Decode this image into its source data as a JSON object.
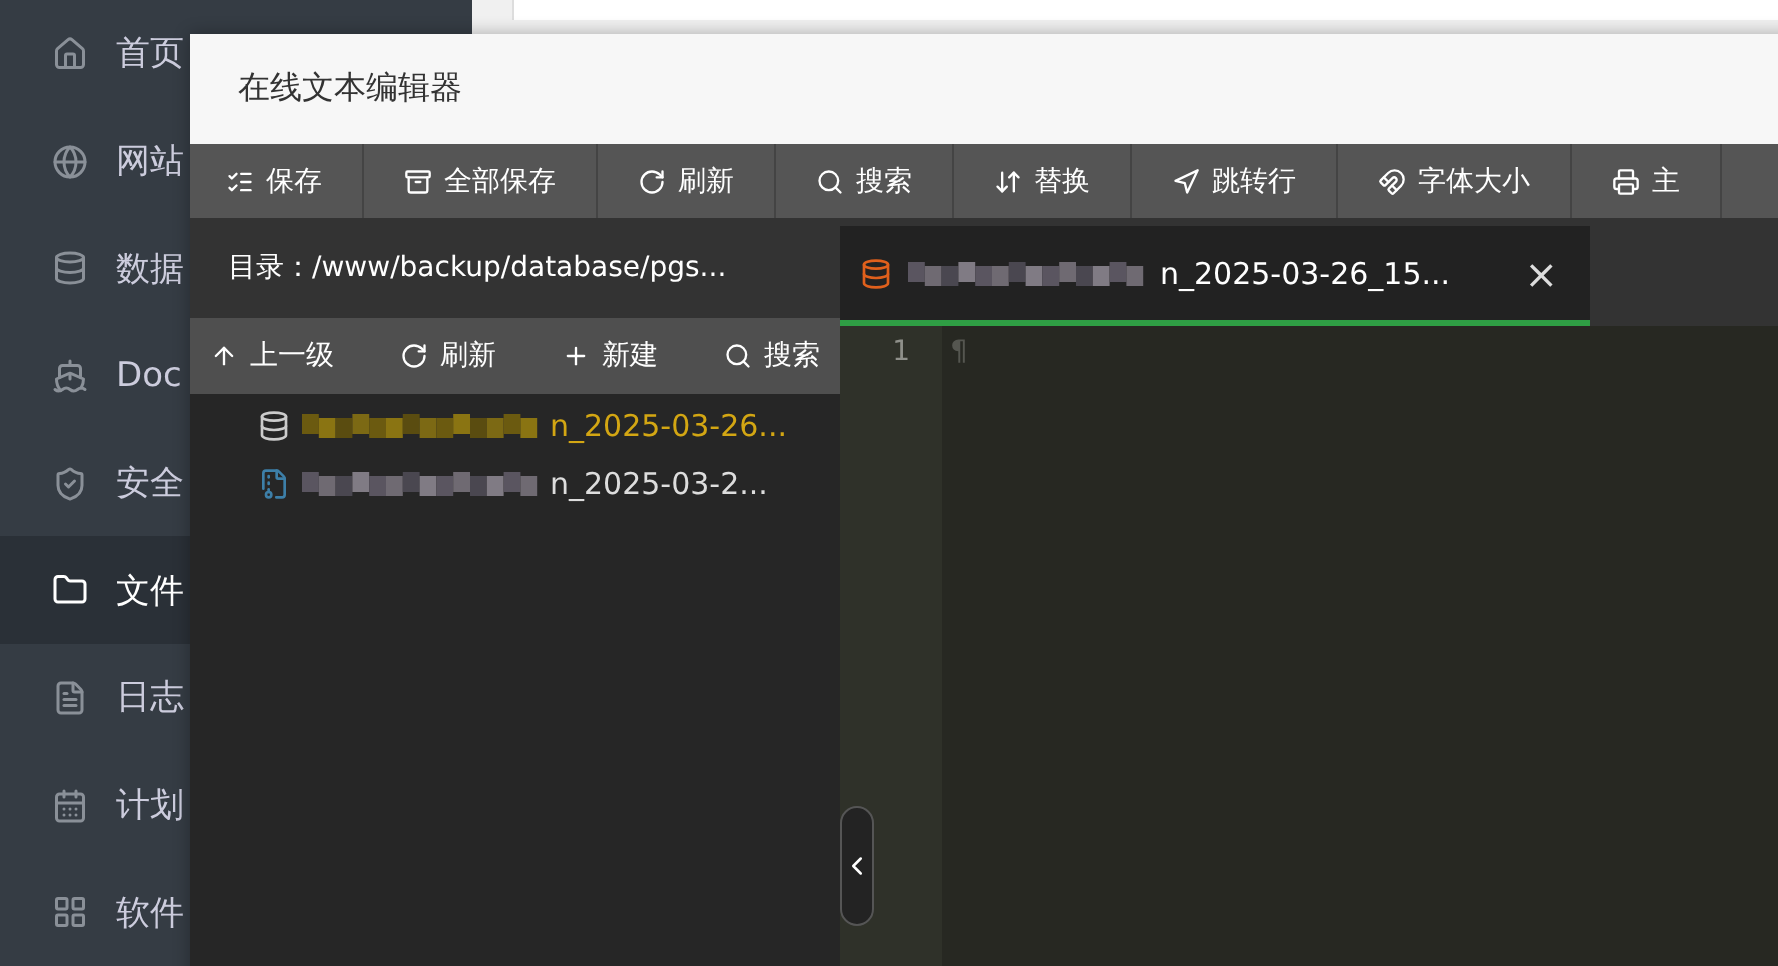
{
  "sidebar": {
    "items": [
      {
        "kind": "home",
        "label": "首页",
        "selected": false
      },
      {
        "kind": "globe",
        "label": "网站",
        "selected": false
      },
      {
        "kind": "database",
        "label": "数据",
        "selected": false
      },
      {
        "kind": "docker",
        "label": "Doc",
        "selected": false
      },
      {
        "kind": "shield",
        "label": "安全",
        "selected": false
      },
      {
        "kind": "folder",
        "label": "文件",
        "selected": true
      },
      {
        "kind": "log",
        "label": "日志",
        "selected": false
      },
      {
        "kind": "calendar",
        "label": "计划",
        "selected": false
      },
      {
        "kind": "grid",
        "label": "软件",
        "selected": false
      }
    ]
  },
  "dialog": {
    "title": "在线文本编辑器",
    "toolbar": [
      {
        "kind": "save",
        "label": "保存"
      },
      {
        "kind": "saveall",
        "label": "全部保存"
      },
      {
        "kind": "refresh",
        "label": "刷新"
      },
      {
        "kind": "search",
        "label": "搜索"
      },
      {
        "kind": "replace",
        "label": "替换"
      },
      {
        "kind": "goto",
        "label": "跳转行"
      },
      {
        "kind": "font",
        "label": "字体大小"
      },
      {
        "kind": "theme",
        "label": "主"
      }
    ],
    "path": "目录：/www/backup/database/pgs...",
    "file_toolbar": [
      {
        "kind": "up",
        "label": "上一级"
      },
      {
        "kind": "refresh",
        "label": "刷新"
      },
      {
        "kind": "new",
        "label": "新建"
      },
      {
        "kind": "search",
        "label": "搜索"
      }
    ],
    "files": [
      {
        "kind": "database",
        "name": "n_2025-03-26...",
        "selected": true
      },
      {
        "kind": "archive",
        "name": "n_2025-03-2...",
        "selected": false
      }
    ],
    "tabs": [
      {
        "name": "n_2025-03-26_15...",
        "close": "×",
        "selected": true
      }
    ],
    "editor": {
      "line_numbers": [
        "1"
      ],
      "lines": [
        "¶"
      ]
    }
  }
}
